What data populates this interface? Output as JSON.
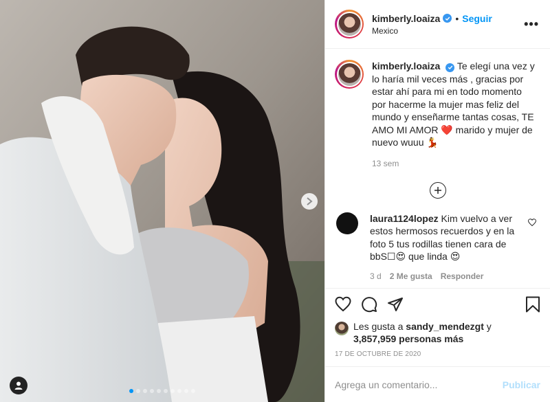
{
  "post": {
    "author": {
      "username": "kimberly.loaiza",
      "verified": true,
      "location": "Mexico",
      "follow_label": "Seguir",
      "separator": "•"
    },
    "caption": {
      "username": "kimberly.loaiza",
      "text_1": "Te elegí una vez y lo haría mil veces más , gracias por estar ahí para mi en todo momento por hacerme la mujer mas feliz del mundo y enseñarme tantas cosas, TE AMO MI AMOR ",
      "emoji_heart": "❤️",
      "text_2": " marido y mujer de nuevo wuuu ",
      "emoji_dancer": "💃",
      "age": "13 sem"
    },
    "comment": {
      "username": "laura1124lopez",
      "text_1": "Kim vuelvo a ver estos hermosos recuerdos y en la foto 5 tus rodillas tienen cara de bb",
      "boxed_char": "S☐",
      "emoji_love": "😍",
      "text_2": " que linda",
      "emoji_love2": "😍",
      "age": "3 d",
      "likes": "2 Me gusta",
      "reply_label": "Responder"
    },
    "likes": {
      "prefix": "Les gusta a ",
      "user": "sandy_mendezgt",
      "mid": " y",
      "count": "3,857,959 personas más"
    },
    "date": "17 DE OCTUBRE DE 2020",
    "add_comment": {
      "placeholder": "Agrega un comentario...",
      "publish_label": "Publicar"
    },
    "carousel": {
      "total": 10,
      "active": 0
    },
    "colors": {
      "accent": "#0095f6",
      "verified": "#3897f0",
      "muted": "#8e8e8e",
      "publish_disabled": "#b2dffc"
    },
    "icons": [
      "next-arrow-icon",
      "tag-user-icon",
      "verified-icon",
      "more-icon",
      "plus-icon",
      "heart-icon",
      "comment-icon",
      "share-icon",
      "bookmark-icon"
    ]
  }
}
